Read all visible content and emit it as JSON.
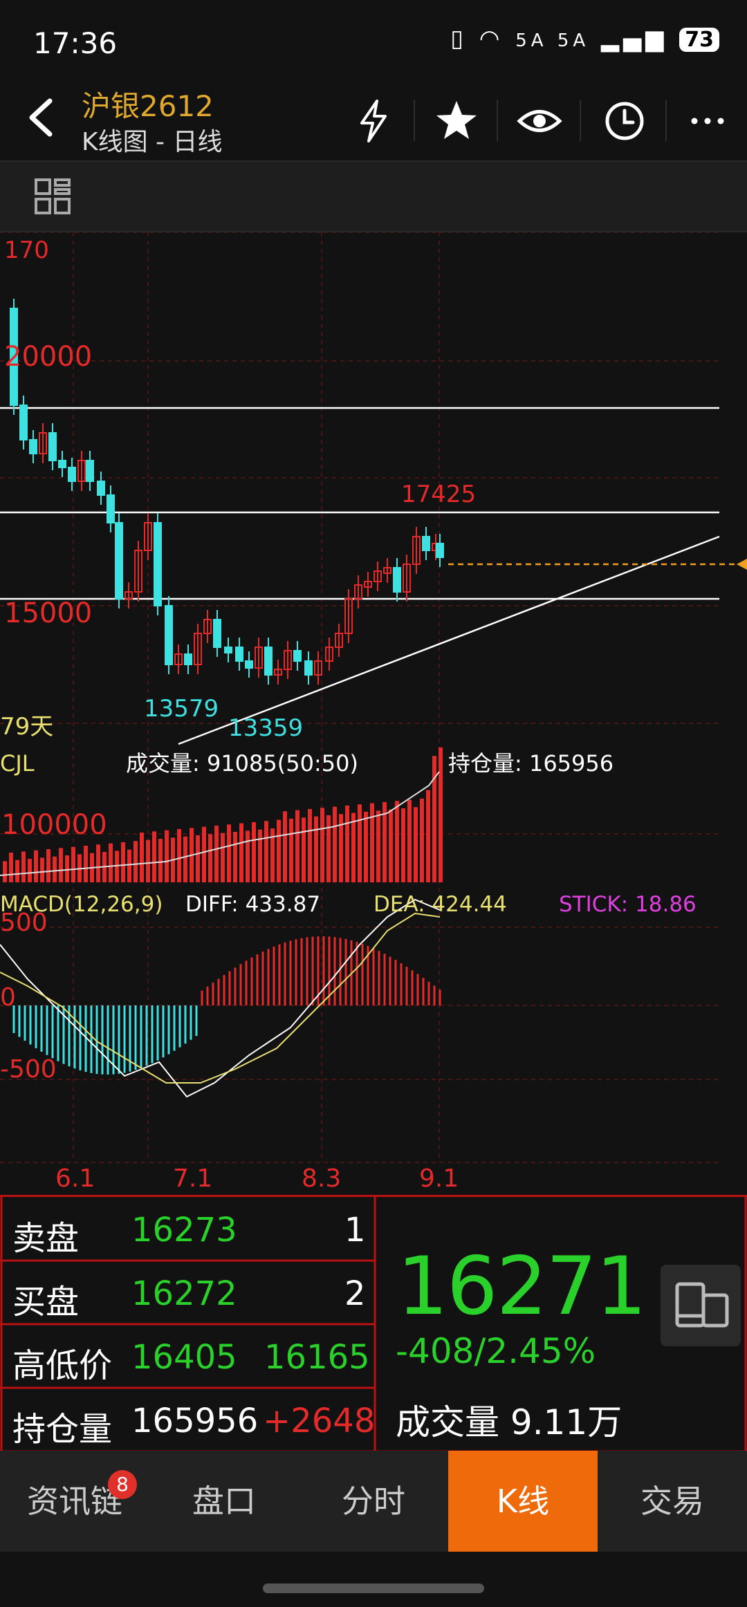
{
  "status_bar": {
    "time": "17:36",
    "signal_text": "5A 5A",
    "battery": "73"
  },
  "header": {
    "title": "沪银2612",
    "subtitle": "K线图 - 日线"
  },
  "icons": [
    "back-icon",
    "lightning-icon",
    "star-icon",
    "eye-icon",
    "clock-icon",
    "more-icon",
    "grid-icon",
    "split-screen-icon"
  ],
  "chart": {
    "price_labels": {
      "top": "170",
      "p20000": "20000",
      "p15000": "15000"
    },
    "high_label": "17425",
    "low_labels": {
      "low1": "13579",
      "low2": "13359"
    },
    "days_label": "79天",
    "cjl": {
      "title": "CJL",
      "volume": "成交量: 91085(50:50)",
      "open_interest": "持仓量: 165956",
      "axis": "100000"
    },
    "macd": {
      "title": "MACD(12,26,9)",
      "diff": "DIFF: 433.87",
      "dea": "DEA: 424.44",
      "stick": "STICK: 18.86",
      "axis_top": "500",
      "axis_zero": "0",
      "axis_bottom": "-500"
    },
    "dates": [
      "6.1",
      "7.1",
      "8.3",
      "9.1"
    ],
    "colors": {
      "up": "#e52a2a",
      "down": "#3ee0e0",
      "dea": "#e8e070",
      "stick": "#e040e0"
    }
  },
  "chart_data": {
    "type": "candlestick",
    "title": "沪银2612",
    "price_levels": [
      20000,
      15000
    ],
    "marked_high": 17425,
    "marked_lows": [
      13579,
      13359
    ],
    "x_ticks": [
      "6.1",
      "7.1",
      "8.3",
      "9.1"
    ],
    "volume_label": "91085",
    "open_interest": 165956,
    "macd": {
      "diff": 433.87,
      "dea": 424.44,
      "stick": 18.86,
      "y_ticks": [
        500,
        0,
        -500
      ]
    }
  },
  "book": {
    "sell_label": "卖盘",
    "sell_price": "16273",
    "sell_qty": "1",
    "buy_label": "买盘",
    "buy_price": "16272",
    "buy_qty": "2",
    "hl_label": "高低价",
    "high": "16405",
    "low": "16165",
    "oi_label": "持仓量",
    "oi": "165956",
    "oi_change": "+2648",
    "last_price": "16271",
    "change": "-408/2.45%",
    "volume": "成交量 9.11万"
  },
  "nav": {
    "items": [
      "资讯链",
      "盘口",
      "分时",
      "K线",
      "交易"
    ],
    "badge": "8"
  }
}
